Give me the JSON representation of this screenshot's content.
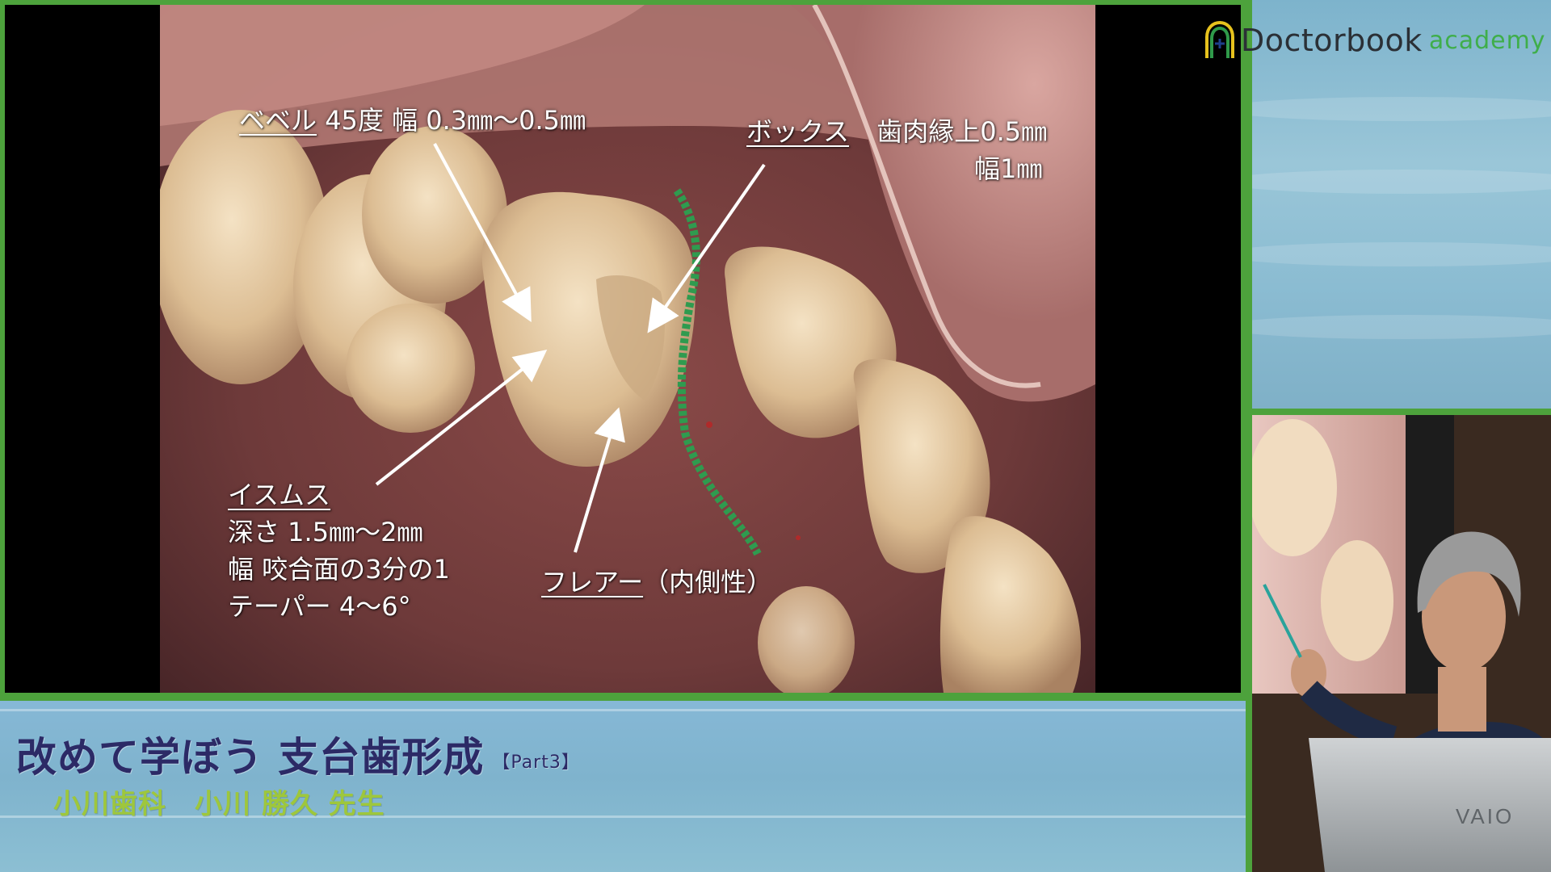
{
  "slide": {
    "annotations": {
      "bevel_label": "ベベル",
      "bevel_detail": "45度 幅 0.3㎜～0.5㎜",
      "box_label": "ボックス",
      "box_detail_1": "歯肉縁上0.5㎜",
      "box_detail_2": "幅1㎜",
      "isthmus_label": "イスムス",
      "isthmus_line1": "深さ 1.5㎜～2㎜",
      "isthmus_line2": "幅 咬合面の3分の1",
      "isthmus_line3": "テーパー 4～6°",
      "flare_label": "フレアー",
      "flare_detail": "（内側性）"
    }
  },
  "course": {
    "title": "改めて学ぼう 支台歯形成",
    "part": "【Part3】",
    "presenter": "小川歯科　小川 勝久 先生"
  },
  "brand": {
    "name": "Doctorbook",
    "sub": "academy"
  },
  "camera": {
    "laptop_brand": "VAIO"
  },
  "colors": {
    "frame_green": "#4da23c",
    "title_text": "#2c2a66",
    "presenter_text": "#9ec73c",
    "logo_green": "#3fae4a"
  }
}
